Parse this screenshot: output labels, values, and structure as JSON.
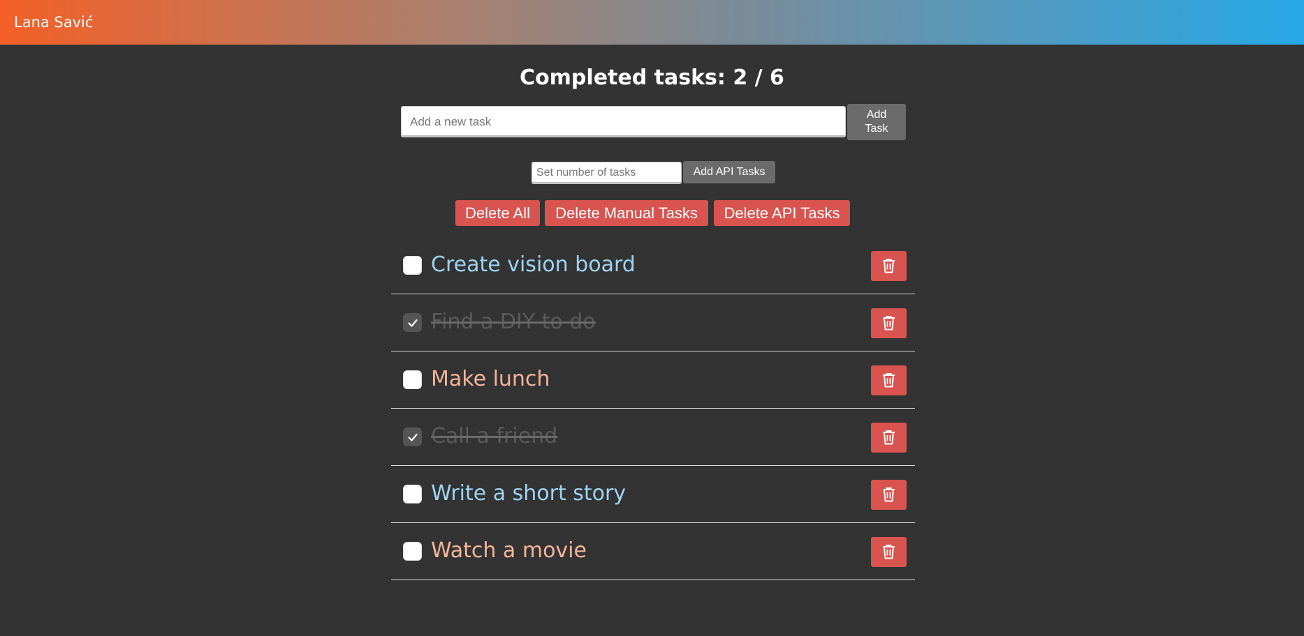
{
  "header": {
    "brand": "Lana Savić"
  },
  "summary": {
    "title": "Completed tasks: 2 / 6"
  },
  "add_task": {
    "placeholder": "Add a new task",
    "value": "",
    "button_label": "Add Task"
  },
  "api_tasks": {
    "placeholder": "Set number of tasks",
    "value": "",
    "button_label": "Add API Tasks"
  },
  "delete_actions": {
    "delete_all": "Delete All",
    "delete_manual": "Delete Manual Tasks",
    "delete_api": "Delete API Tasks"
  },
  "tasks": [
    {
      "text": "Create vision board",
      "completed": false,
      "color": "#9ed3f2"
    },
    {
      "text": "Find a DIY to do",
      "completed": true,
      "color": "#5a5a5a"
    },
    {
      "text": "Make lunch",
      "completed": false,
      "color": "#f5b49a"
    },
    {
      "text": "Call a friend",
      "completed": true,
      "color": "#5a5a5a"
    },
    {
      "text": "Write a short story",
      "completed": false,
      "color": "#9ed3f2"
    },
    {
      "text": "Watch a movie",
      "completed": false,
      "color": "#f5b49a"
    }
  ],
  "colors": {
    "background": "#333333",
    "danger": "#d9534f",
    "neutral_button": "#6b6b6b",
    "header_gradient_start": "#f46027",
    "header_gradient_end": "#27a8e6"
  },
  "icons": {
    "task_delete": "trash-icon",
    "task_checked": "checkmark-icon"
  }
}
